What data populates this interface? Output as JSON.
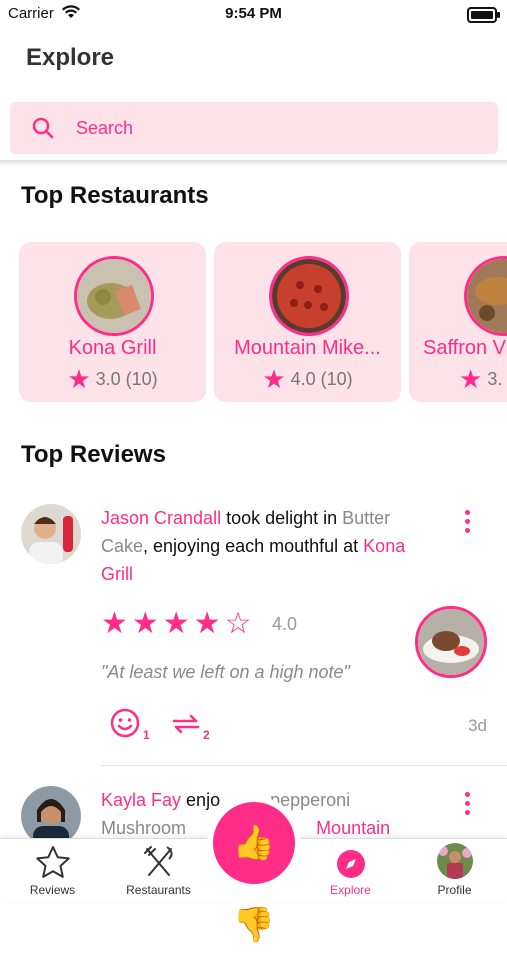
{
  "status": {
    "carrier": "Carrier",
    "time": "9:54 PM"
  },
  "header": {
    "title": "Explore"
  },
  "search": {
    "placeholder": "Search"
  },
  "sections": {
    "restaurants": "Top Restaurants",
    "reviews": "Top Reviews"
  },
  "restaurants": [
    {
      "name": "Kona Grill",
      "rating": "3.0 (10)"
    },
    {
      "name": "Mountain Mike...",
      "rating": "4.0 (10)"
    },
    {
      "name": "Saffron V",
      "rating": "3."
    }
  ],
  "reviews": [
    {
      "user": "Jason Crandall",
      "verb": " took delight in ",
      "dish": "Butter Cake",
      "mid": ", enjoying each mouthful at ",
      "place": "Kona Grill",
      "stars": "★★★★☆",
      "score": "4.0",
      "quote": "\"At least we left on a high note\"",
      "likes": "1",
      "reposts": "2",
      "age": "3d"
    },
    {
      "user": "Kayla Fay",
      "line1_rest": " enjo",
      "dish_part": "pepperoni",
      "line2_start": "Mushroom",
      "place_part": "Mountain"
    }
  ],
  "tabs": [
    {
      "label": "Reviews",
      "icon": "star-outline-icon"
    },
    {
      "label": "Restaurants",
      "icon": "fork-knife-icon"
    },
    {
      "label": "",
      "icon": "thumbs-icon"
    },
    {
      "label": "Explore",
      "icon": "compass-icon"
    },
    {
      "label": "Profile",
      "icon": "avatar-icon"
    }
  ],
  "colors": {
    "accent": "#ff2d87",
    "card_bg": "#fde2ea"
  }
}
